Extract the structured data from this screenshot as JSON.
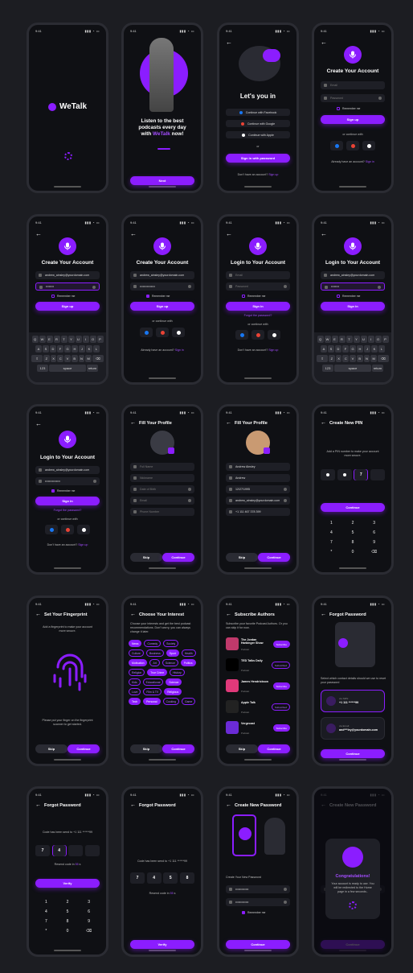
{
  "app_name": "WeTalk",
  "accent": "#8b1dff",
  "status_time": "9:41",
  "onboarding": {
    "headline_lines": [
      "Listen to the best",
      "podcasts every day",
      "with "
    ],
    "headline_brand": "WeTalk",
    "headline_suffix": " now!",
    "next": "Next"
  },
  "lets_in": {
    "title": "Let's you in",
    "facebook": "Continue with Facebook",
    "google": "Continue with Google",
    "apple": "Continue with Apple",
    "or": "or",
    "password_btn": "Sign in with password",
    "no_account": "Don't have an account?",
    "signup_link": "Sign up"
  },
  "create_account": {
    "title": "Create Your Account",
    "email_ph": "Email",
    "password_ph": "Password",
    "remember": "Remember me",
    "signup": "Sign up",
    "or_continue": "or continue with",
    "have_account": "Already have an account?",
    "signin_link": "Sign in",
    "email_value": "andrew_ainsley@yourdomain.com",
    "password_mask": "••••••••",
    "password_mask_long": "•••••••••••••••"
  },
  "login": {
    "title": "Login to Your Account",
    "email_ph": "Email",
    "password_ph": "Password",
    "remember": "Remember me",
    "signin": "Sign in",
    "forgot": "Forgot the password?",
    "or_continue": "or continue with",
    "no_account": "Don't have an account?",
    "signup_link": "Sign up"
  },
  "keyboard": {
    "rows": [
      [
        "Q",
        "W",
        "E",
        "R",
        "T",
        "Y",
        "U",
        "I",
        "O",
        "P"
      ],
      [
        "A",
        "S",
        "D",
        "F",
        "G",
        "H",
        "J",
        "K",
        "L"
      ],
      [
        "⇧",
        "Z",
        "X",
        "C",
        "V",
        "B",
        "N",
        "M",
        "⌫"
      ]
    ],
    "num": "123",
    "space": "space",
    "ret": "return"
  },
  "profile": {
    "title": "Fill Your Profile",
    "placeholders": [
      "Full Name",
      "Nickname",
      "Date of Birth",
      "Email",
      "Phone Number"
    ],
    "values": [
      "Andrew Ainsley",
      "Andrew",
      "12/27/1995",
      "andrew_ainsley@yourdomain.com",
      "+1 111 467 378 399"
    ],
    "skip": "Skip",
    "continue": "Continue"
  },
  "pin": {
    "title": "Create New PIN",
    "desc": "Add a PIN number to make your account more secure.",
    "entered": "7",
    "continue": "Continue",
    "keys": [
      "1",
      "2",
      "3",
      "4",
      "5",
      "6",
      "7",
      "8",
      "9",
      "*",
      "0",
      "⌫"
    ]
  },
  "fingerprint": {
    "title": "Set Your Fingerprint",
    "desc": "Add a fingerprint to make your account more secure.",
    "hint": "Please put your finger on the fingerprint scanner to get started.",
    "skip": "Skip",
    "continue": "Continue"
  },
  "interest": {
    "title": "Choose Your Interest",
    "desc": "Choose your interests and get the best podcast recommendations. Don't worry, you can always change it later.",
    "chips": [
      [
        "News",
        true
      ],
      [
        "Comedy",
        false
      ],
      [
        "Society",
        false
      ],
      [
        "Culture",
        false
      ],
      [
        "Business",
        false
      ],
      [
        "Sport",
        true
      ],
      [
        "Health",
        false
      ],
      [
        "Motivation",
        true
      ],
      [
        "Art",
        false
      ],
      [
        "Science",
        false
      ],
      [
        "Politics",
        true
      ],
      [
        "Religion",
        false
      ],
      [
        "True Crime",
        true
      ],
      [
        "History",
        false
      ],
      [
        "Kids",
        false
      ],
      [
        "Educational",
        false
      ],
      [
        "Science",
        true
      ],
      [
        "Love",
        false
      ],
      [
        "Film & TV",
        false
      ],
      [
        "Religious",
        true
      ],
      [
        "Tech",
        true
      ],
      [
        "Personal",
        true
      ],
      [
        "Cooking",
        false
      ],
      [
        "Game",
        false
      ]
    ],
    "skip": "Skip",
    "continue": "Continue"
  },
  "authors": {
    "title": "Subscribe Authors",
    "desc": "Subscribe your favorite Podcast Authors. Or you can skip it for now.",
    "list": [
      {
        "name": "The Jordan Harbinger Show",
        "sub": "Podcast",
        "btn": "Subscribe",
        "on": true,
        "color": "#c0396b"
      },
      {
        "name": "TED Talks Daily",
        "sub": "Podcast",
        "btn": "Subscribed",
        "on": false,
        "color": "#000000"
      },
      {
        "name": "James Hendrickson",
        "sub": "Podcast",
        "btn": "Subscribe",
        "on": true,
        "color": "#e0397a"
      },
      {
        "name": "Apple Talk",
        "sub": "Podcast",
        "btn": "Subscribed",
        "on": false,
        "color": "#222222"
      },
      {
        "name": "Vergecast",
        "sub": "Podcast",
        "btn": "Subscribe",
        "on": true,
        "color": "#6b2bd6"
      }
    ],
    "skip": "Skip",
    "continue": "Continue"
  },
  "forgot": {
    "title": "Forgot Password",
    "desc": "Select which contact details should we use to reset your password",
    "via_sms": "via SMS:",
    "sms": "+1 111 ******99",
    "via_email": "via Email:",
    "email": "and***ley@yourdomain.com",
    "continue": "Continue",
    "code_sent": "Code has been send to +1 111 ******99",
    "code": [
      "7",
      "4",
      "",
      ""
    ],
    "code_full": [
      "7",
      "4",
      "5",
      "8"
    ],
    "resend": "Resend code in ",
    "resend_sec": "55",
    "resend_unit": " s",
    "verify": "Verify"
  },
  "new_password": {
    "title": "Create New Password",
    "label": "Create Your New Password",
    "mask": "•••••••••••••",
    "remember": "Remember me",
    "continue": "Continue",
    "modal_title": "Congratulations!",
    "modal_text": "Your account is ready to use. You will be redirected to the Home page in a few seconds.."
  }
}
